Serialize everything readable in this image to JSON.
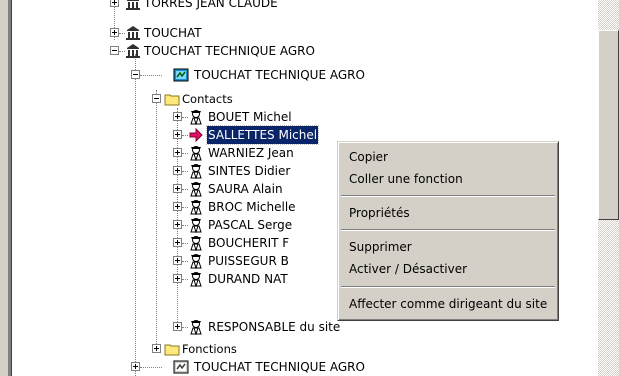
{
  "tree": {
    "nodes": [
      {
        "label": "TORRES JEAN CLAUDE",
        "icon": "building-icon",
        "expander": "plus"
      },
      {
        "label": "TOUCHAT",
        "icon": "building-icon",
        "expander": "plus"
      },
      {
        "label": "TOUCHAT TECHNIQUE AGRO",
        "icon": "building-icon",
        "expander": "minus"
      },
      {
        "label": "TOUCHAT TECHNIQUE AGRO",
        "icon": "site-icon",
        "expander": "minus"
      },
      {
        "label": "Contacts",
        "icon": "folder-icon",
        "expander": "minus"
      },
      {
        "label": "BOUET Michel",
        "icon": "person-icon",
        "expander": "plus"
      },
      {
        "label": "SALLETTES Michel",
        "icon": "arrow-right-icon",
        "expander": "plus",
        "selected": true
      },
      {
        "label": "WARNIEZ Jean",
        "icon": "person-icon",
        "expander": "plus"
      },
      {
        "label": "SINTES Didier",
        "icon": "person-icon",
        "expander": "plus"
      },
      {
        "label": "SAURA Alain",
        "icon": "person-icon",
        "expander": "plus"
      },
      {
        "label": "BROC Michelle",
        "icon": "person-icon",
        "expander": "plus"
      },
      {
        "label": "PASCAL Serge",
        "icon": "person-icon",
        "expander": "plus"
      },
      {
        "label": "BOUCHERIT F",
        "icon": "person-icon",
        "expander": "plus"
      },
      {
        "label": "PUISSEGUR B",
        "icon": "person-icon",
        "expander": "plus"
      },
      {
        "label": "DURAND NAT",
        "icon": "person-icon",
        "expander": "plus"
      },
      {
        "label": "RESPONSABLE du site",
        "icon": "person-icon",
        "expander": "plus"
      },
      {
        "label": "Fonctions",
        "icon": "folder-icon",
        "expander": "plus"
      },
      {
        "label": "TOUCHAT TECHNIQUE AGRO",
        "icon": "site-icon",
        "expander": "plus"
      }
    ]
  },
  "context_menu": {
    "items": [
      "Copier",
      "Coller une fonction",
      "Propriétés",
      "Supprimer",
      "Activer / Désactiver",
      "Affecter comme dirigeant du site"
    ]
  },
  "colors": {
    "selection": "#0a246a",
    "menu_bg": "#d4d0c8",
    "folder": "#ffe87c",
    "arrow": "#e0106a"
  }
}
